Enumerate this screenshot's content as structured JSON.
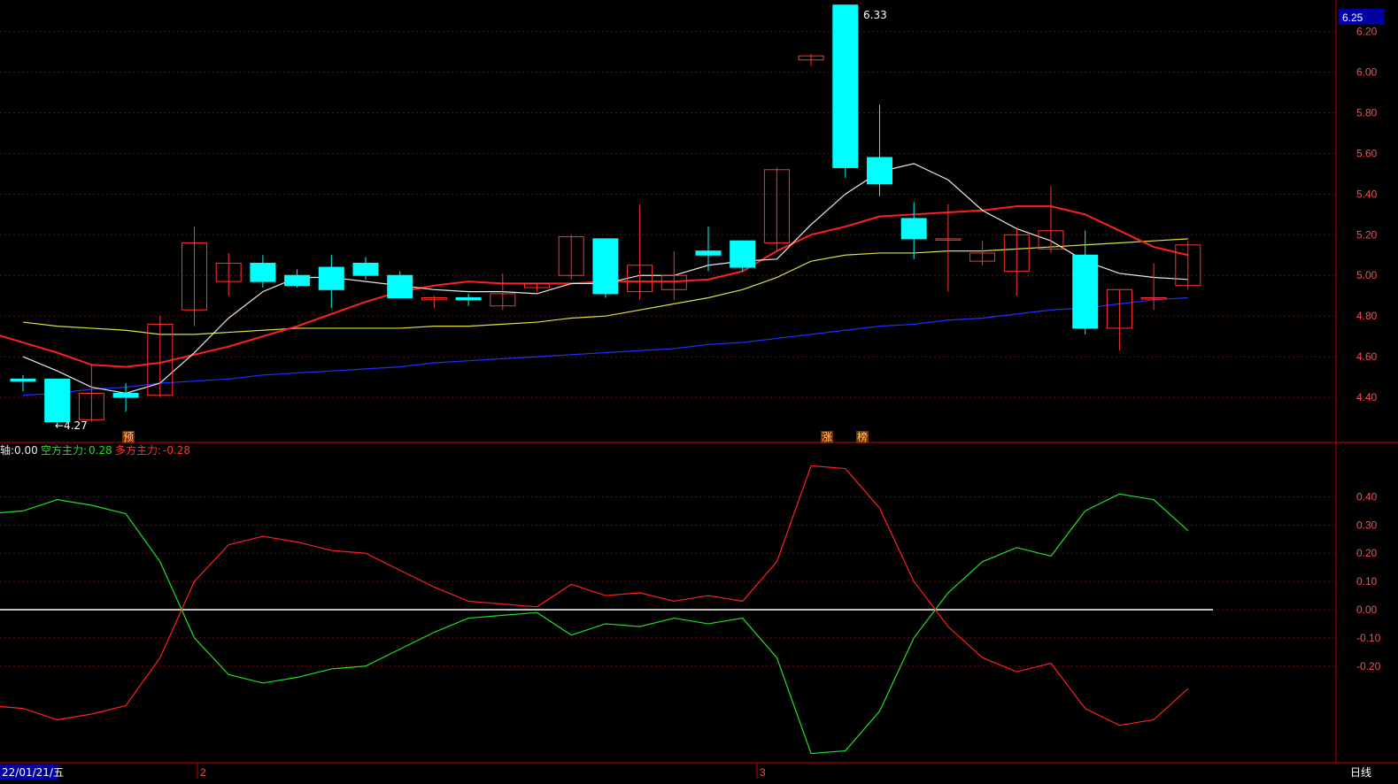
{
  "colors": {
    "bg": "#000000",
    "up": "#ff3232",
    "down": "#00ffff",
    "grid": "#7a0000",
    "axis": "#c80000",
    "ma_white": "#e8e8e8",
    "ma_red": "#ff2020",
    "ma_yellow": "#e0e040",
    "ma_blue": "#2030ff",
    "kong": "#20e020",
    "duo": "#ff2020",
    "zero": "#ffffff",
    "highlight_bg": "#0000a0"
  },
  "price_panel": {
    "current_price": "6.25",
    "high_label": "6.33",
    "low_label": "←4.27",
    "markers": [
      {
        "label": "预",
        "candle": 3
      },
      {
        "label": "涨",
        "candle": 24
      },
      {
        "label": "榜",
        "candle": 25
      }
    ]
  },
  "indicator_panel": {
    "axis_label": "轴:",
    "axis_value": "0.00",
    "kong_label": "空方主力:",
    "kong_value": "0.28",
    "duo_label": "多方主力:",
    "duo_value": "-0.28"
  },
  "footer": {
    "date": "22/01/21/五",
    "month_2": "2",
    "month_3": "3",
    "period": "日线"
  },
  "chart_data": [
    {
      "type": "candlestick",
      "ylim": [
        4.2,
        6.32
      ],
      "yticks": [
        "6.20",
        "6.00",
        "5.80",
        "5.60",
        "5.40",
        "5.20",
        "5.00",
        "4.80",
        "4.60",
        "4.40"
      ],
      "candles": [
        {
          "o": 4.49,
          "h": 4.51,
          "l": 4.43,
          "c": 4.48
        },
        {
          "o": 4.49,
          "h": 4.49,
          "l": 4.27,
          "c": 4.28
        },
        {
          "o": 4.29,
          "h": 4.56,
          "l": 4.28,
          "c": 4.42
        },
        {
          "o": 4.42,
          "h": 4.47,
          "l": 4.33,
          "c": 4.4
        },
        {
          "o": 4.41,
          "h": 4.8,
          "l": 4.4,
          "c": 4.76
        },
        {
          "o": 4.83,
          "h": 5.24,
          "l": 4.75,
          "c": 5.16
        },
        {
          "o": 4.97,
          "h": 5.11,
          "l": 4.9,
          "c": 5.06
        },
        {
          "o": 5.06,
          "h": 5.1,
          "l": 4.94,
          "c": 4.97
        },
        {
          "o": 5.0,
          "h": 5.03,
          "l": 4.94,
          "c": 4.95
        },
        {
          "o": 5.04,
          "h": 5.1,
          "l": 4.84,
          "c": 4.93
        },
        {
          "o": 5.06,
          "h": 5.09,
          "l": 4.98,
          "c": 5.0
        },
        {
          "o": 5.0,
          "h": 5.02,
          "l": 4.89,
          "c": 4.89
        },
        {
          "o": 4.88,
          "h": 4.9,
          "l": 4.84,
          "c": 4.89
        },
        {
          "o": 4.89,
          "h": 4.91,
          "l": 4.85,
          "c": 4.88
        },
        {
          "o": 4.85,
          "h": 5.01,
          "l": 4.83,
          "c": 4.91
        },
        {
          "o": 4.94,
          "h": 4.96,
          "l": 4.92,
          "c": 4.96
        },
        {
          "o": 5.0,
          "h": 5.2,
          "l": 4.98,
          "c": 5.19
        },
        {
          "o": 5.18,
          "h": 5.18,
          "l": 4.89,
          "c": 4.91
        },
        {
          "o": 4.92,
          "h": 5.35,
          "l": 4.88,
          "c": 5.05
        },
        {
          "o": 4.93,
          "h": 5.12,
          "l": 4.88,
          "c": 5.0
        },
        {
          "o": 5.12,
          "h": 5.24,
          "l": 5.02,
          "c": 5.1
        },
        {
          "o": 5.17,
          "h": 5.17,
          "l": 5.02,
          "c": 5.04
        },
        {
          "o": 5.16,
          "h": 5.53,
          "l": 5.12,
          "c": 5.52
        },
        {
          "o": 6.06,
          "h": 6.09,
          "l": 6.03,
          "c": 6.08
        },
        {
          "o": 6.33,
          "h": 6.33,
          "l": 5.48,
          "c": 5.53
        },
        {
          "o": 5.58,
          "h": 5.84,
          "l": 5.39,
          "c": 5.45
        },
        {
          "o": 5.28,
          "h": 5.36,
          "l": 5.08,
          "c": 5.18
        },
        {
          "o": 5.18,
          "h": 5.35,
          "l": 4.92,
          "c": 5.18
        },
        {
          "o": 5.07,
          "h": 5.17,
          "l": 5.05,
          "c": 5.11
        },
        {
          "o": 5.02,
          "h": 5.23,
          "l": 4.9,
          "c": 5.2
        },
        {
          "o": 5.13,
          "h": 5.44,
          "l": 5.11,
          "c": 5.22
        },
        {
          "o": 5.1,
          "h": 5.22,
          "l": 4.71,
          "c": 4.74
        },
        {
          "o": 4.74,
          "h": 4.93,
          "l": 4.63,
          "c": 4.93
        },
        {
          "o": 4.89,
          "h": 5.06,
          "l": 4.83,
          "c": 4.89
        },
        {
          "o": 4.95,
          "h": 5.17,
          "l": 4.93,
          "c": 5.15
        }
      ],
      "ma_white": [
        4.6,
        4.53,
        4.45,
        4.42,
        4.47,
        4.62,
        4.79,
        4.92,
        4.99,
        4.99,
        4.97,
        4.95,
        4.93,
        4.92,
        4.92,
        4.91,
        4.96,
        4.96,
        5.0,
        5.0,
        5.05,
        5.07,
        5.08,
        5.25,
        5.4,
        5.51,
        5.55,
        5.47,
        5.32,
        5.23,
        5.17,
        5.07,
        5.01,
        4.99,
        4.98
      ],
      "ma_red": [
        4.72,
        4.67,
        4.62,
        4.56,
        4.55,
        4.57,
        4.61,
        4.65,
        4.7,
        4.75,
        4.81,
        4.87,
        4.92,
        4.95,
        4.97,
        4.96,
        4.96,
        4.96,
        4.97,
        4.97,
        4.97,
        4.98,
        5.02,
        5.12,
        5.2,
        5.24,
        5.29,
        5.3,
        5.31,
        5.32,
        5.34,
        5.34,
        5.3,
        5.22,
        5.14,
        5.1
      ],
      "ma_yellow": [
        4.77,
        4.75,
        4.74,
        4.73,
        4.71,
        4.71,
        4.72,
        4.73,
        4.74,
        4.74,
        4.74,
        4.74,
        4.75,
        4.75,
        4.76,
        4.77,
        4.79,
        4.8,
        4.83,
        4.86,
        4.89,
        4.93,
        4.99,
        5.07,
        5.1,
        5.11,
        5.11,
        5.12,
        5.12,
        5.13,
        5.14,
        5.15,
        5.16,
        5.17,
        5.18
      ],
      "ma_blue": [
        4.41,
        4.42,
        4.44,
        4.45,
        4.47,
        4.48,
        4.49,
        4.51,
        4.52,
        4.53,
        4.54,
        4.55,
        4.57,
        4.58,
        4.59,
        4.6,
        4.61,
        4.62,
        4.63,
        4.64,
        4.66,
        4.67,
        4.69,
        4.71,
        4.73,
        4.75,
        4.76,
        4.78,
        4.79,
        4.81,
        4.83,
        4.84,
        4.86,
        4.88,
        4.89
      ]
    },
    {
      "type": "line",
      "ylim": [
        -0.53,
        0.53
      ],
      "yticks": [
        "0.40",
        "0.30",
        "0.20",
        "0.10",
        "0.00",
        "-0.10",
        "-0.20"
      ],
      "series": [
        {
          "name": "空方主力",
          "values": [
            0.34,
            0.35,
            0.39,
            0.37,
            0.34,
            0.17,
            -0.1,
            -0.23,
            -0.26,
            -0.24,
            -0.21,
            -0.2,
            -0.14,
            -0.08,
            -0.03,
            -0.02,
            -0.01,
            -0.09,
            -0.05,
            -0.06,
            -0.03,
            -0.05,
            -0.03,
            -0.17,
            -0.51,
            -0.5,
            -0.36,
            -0.1,
            0.06,
            0.17,
            0.22,
            0.19,
            0.35,
            0.41,
            0.39,
            0.28
          ]
        },
        {
          "name": "多方主力",
          "values": [
            -0.34,
            -0.35,
            -0.39,
            -0.37,
            -0.34,
            -0.17,
            0.1,
            0.23,
            0.26,
            0.24,
            0.21,
            0.2,
            0.14,
            0.08,
            0.03,
            0.02,
            0.01,
            0.09,
            0.05,
            0.06,
            0.03,
            0.05,
            0.03,
            0.17,
            0.51,
            0.5,
            0.36,
            0.1,
            -0.06,
            -0.17,
            -0.22,
            -0.19,
            -0.35,
            -0.41,
            -0.39,
            -0.28
          ]
        }
      ]
    }
  ]
}
